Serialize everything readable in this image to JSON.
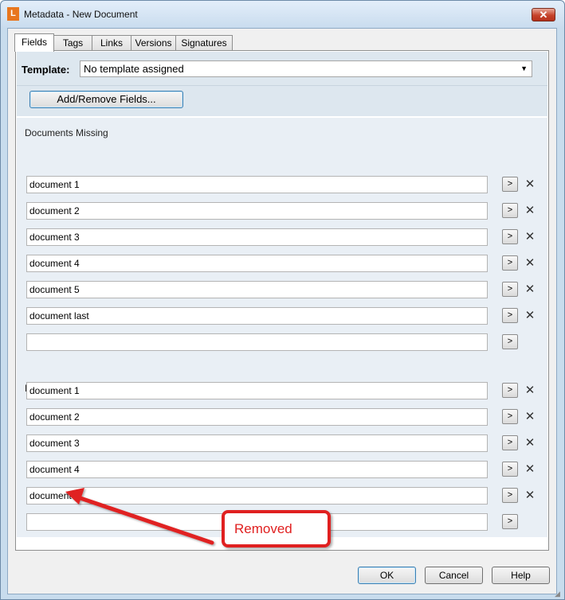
{
  "window": {
    "title": "Metadata - New Document",
    "app_icon_letter": "L",
    "close_glyph": "✕"
  },
  "tabs": [
    {
      "label": "Fields",
      "active": true
    },
    {
      "label": "Tags",
      "active": false
    },
    {
      "label": "Links",
      "active": false
    },
    {
      "label": "Versions",
      "active": false
    },
    {
      "label": "Signatures",
      "active": false
    }
  ],
  "template": {
    "label": "Template:",
    "value": "No template assigned",
    "arrow": "▼"
  },
  "add_remove_label": "Add/Remove Fields...",
  "sections": [
    {
      "label": "Documents Missing",
      "values": [
        "document 1",
        "document 2",
        "document 3",
        "document 4",
        "document 5",
        "document last",
        ""
      ]
    },
    {
      "label": "Required Vendor Documents",
      "values": [
        "document 1",
        "document 2",
        "document 3",
        "document 4",
        "document 5",
        ""
      ]
    }
  ],
  "row_button_glyph": ">",
  "remove_glyph": "✕",
  "buttons": {
    "ok": "OK",
    "cancel": "Cancel",
    "help": "Help"
  },
  "annotation": {
    "text": "Removed",
    "color": "#e02020"
  },
  "colors": {
    "accent": "#3c7fb1",
    "app_icon": "#e8761e",
    "close": "#c6442a"
  }
}
